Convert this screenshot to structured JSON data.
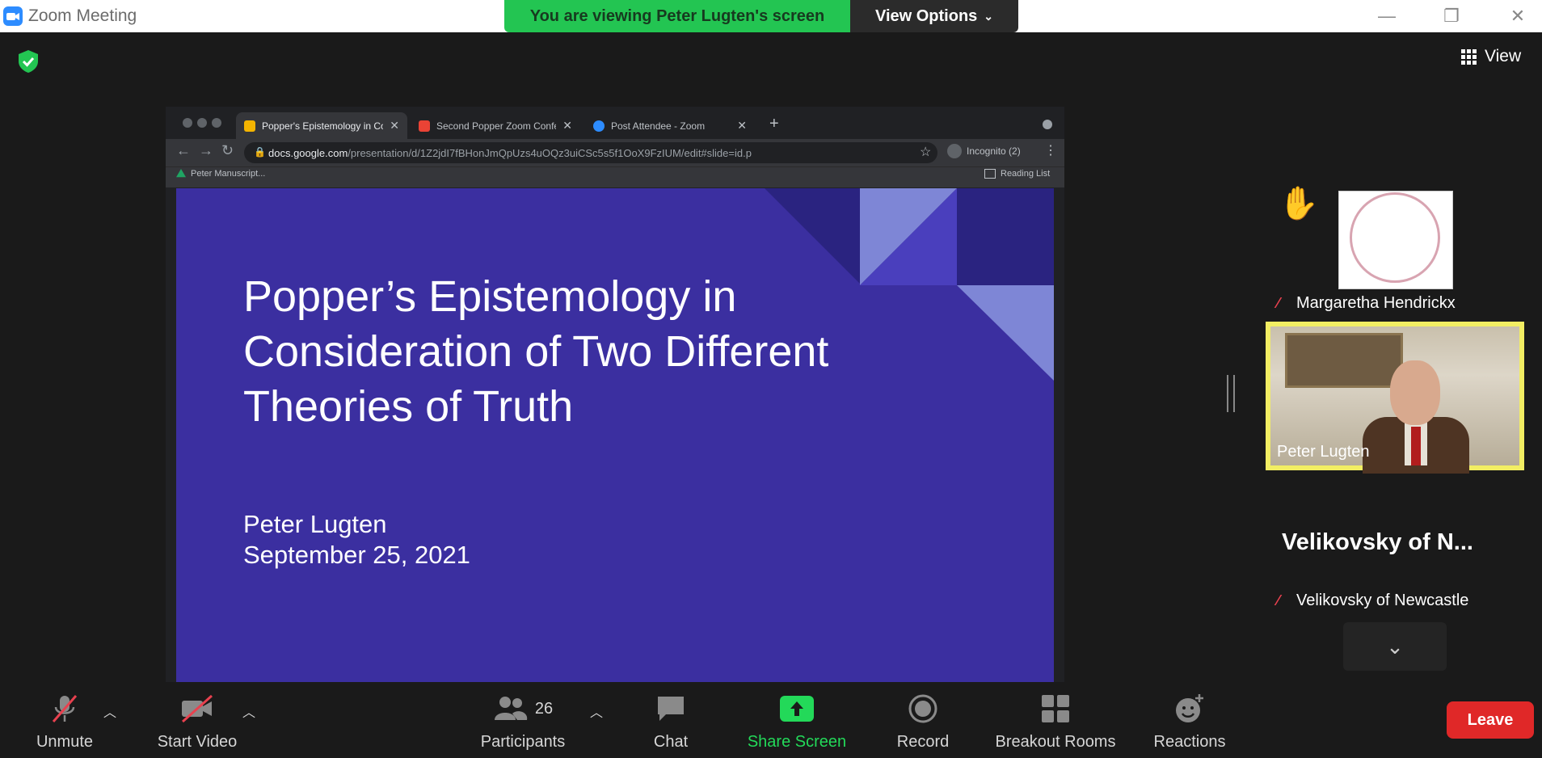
{
  "window": {
    "title": "Zoom Meeting",
    "minimize": "—",
    "restore": "❐",
    "close": "✕"
  },
  "banner": {
    "text": "You are viewing Peter Lugten's screen",
    "view_options": "View Options"
  },
  "view_label": "View",
  "browser": {
    "tabs": [
      {
        "label": "Popper's Epistemology in Con..."
      },
      {
        "label": "Second Popper Zoom Confere..."
      },
      {
        "label": "Post Attendee - Zoom"
      }
    ],
    "new_tab": "+",
    "url_host": "docs.google.com",
    "url_path": "/presentation/d/1Z2jdI7fBHonJmQpUzs4uOQz3uiCSc5s5f1OoX9FzIUM/edit#slide=id.p",
    "incognito": "Incognito (2)",
    "bookmark": "Peter Manuscript...",
    "reading_list": "Reading List"
  },
  "slide": {
    "title": "Popper’s Epistemology in Consideration of Two Different Theories of Truth",
    "author": "Peter Lugten",
    "date": "September 25, 2021",
    "colors": {
      "background": "#3b2fa0",
      "accent_light": "#7e86d6",
      "accent_dark": "#2a2380"
    }
  },
  "participants_panel": {
    "tiles": [
      {
        "name": "Margaretha Hendrickx",
        "muted": true,
        "hand_raised": true
      },
      {
        "name": "Peter Lugten",
        "active_speaker": true
      },
      {
        "display_name": "Velikovsky of N...",
        "name": "Velikovsky of Newcastle",
        "muted": true
      }
    ]
  },
  "toolbar": {
    "unmute": "Unmute",
    "start_video": "Start Video",
    "participants": "Participants",
    "participant_count": "26",
    "chat": "Chat",
    "share_screen": "Share Screen",
    "record": "Record",
    "breakout_rooms": "Breakout Rooms",
    "reactions": "Reactions",
    "leave": "Leave"
  },
  "colors": {
    "banner_green": "#23c552",
    "share_green": "#23d959",
    "leave_red": "#e02828",
    "speaker_highlight": "#f2ee63"
  }
}
